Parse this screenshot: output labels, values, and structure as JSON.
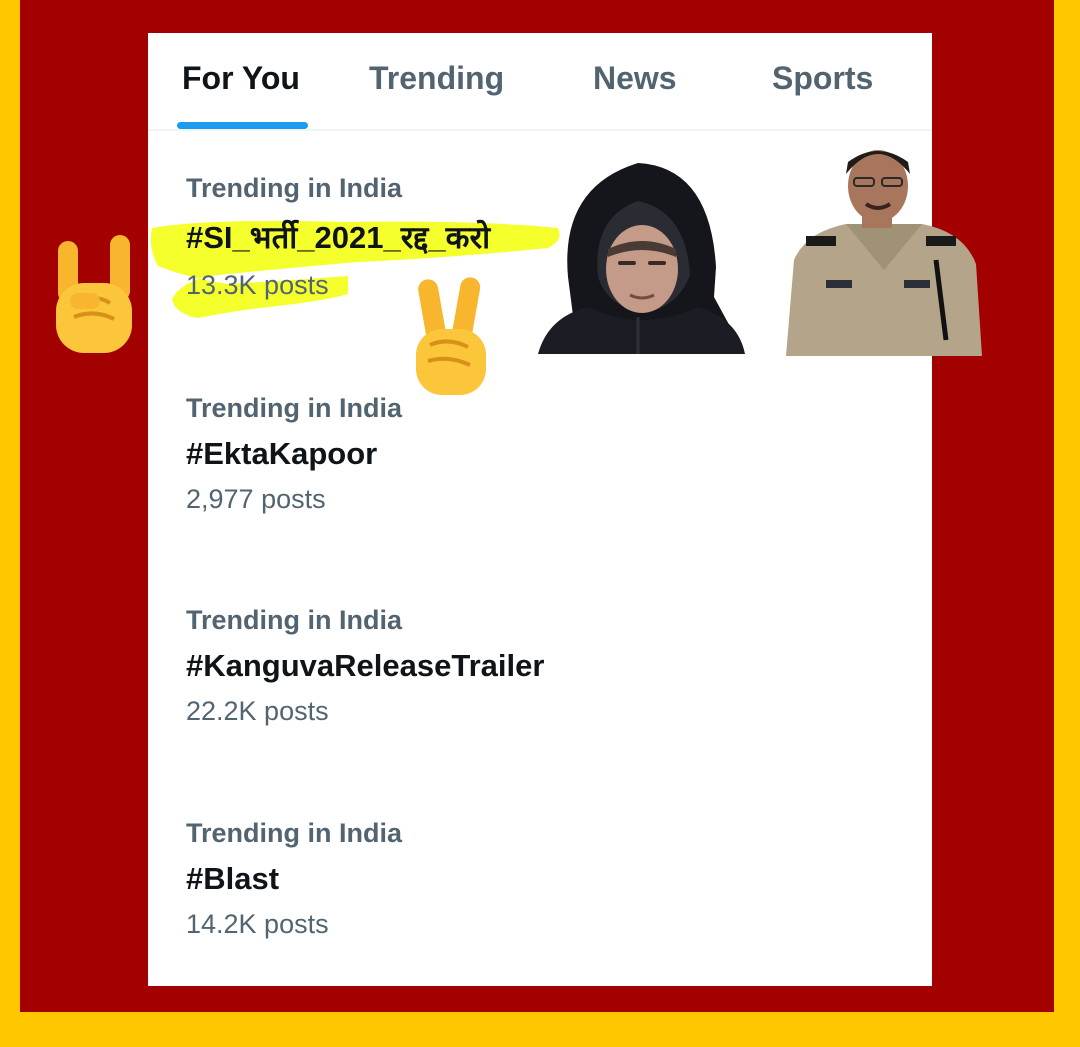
{
  "tabs": [
    {
      "label": "For You",
      "active": true
    },
    {
      "label": "Trending",
      "active": false
    },
    {
      "label": "News",
      "active": false
    },
    {
      "label": "Sports",
      "active": false
    }
  ],
  "trends": [
    {
      "context": "Trending in India",
      "tag": "#SI_भर्ती_2021_रद्द_करो",
      "count": "13.3K posts",
      "highlighted": true
    },
    {
      "context": "Trending in India",
      "tag": "#EktaKapoor",
      "count": "2,977 posts"
    },
    {
      "context": "Trending in India",
      "tag": "#KanguvaReleaseTrailer",
      "count": "22.2K posts"
    },
    {
      "context": "Trending in India",
      "tag": "#Blast",
      "count": "14.2K posts"
    }
  ],
  "stickers": [
    {
      "name": "rock-on-hand-emoji"
    },
    {
      "name": "victory-hand-emoji"
    },
    {
      "name": "hooded-man-photo"
    },
    {
      "name": "police-officer-photo"
    }
  ],
  "colors": {
    "outer_border": "#ffc700",
    "frame": "#a30000",
    "highlight": "#f4ff1a",
    "tab_indicator": "#1d9bf0",
    "primary_text": "#0f1419",
    "secondary_text": "#536471"
  }
}
